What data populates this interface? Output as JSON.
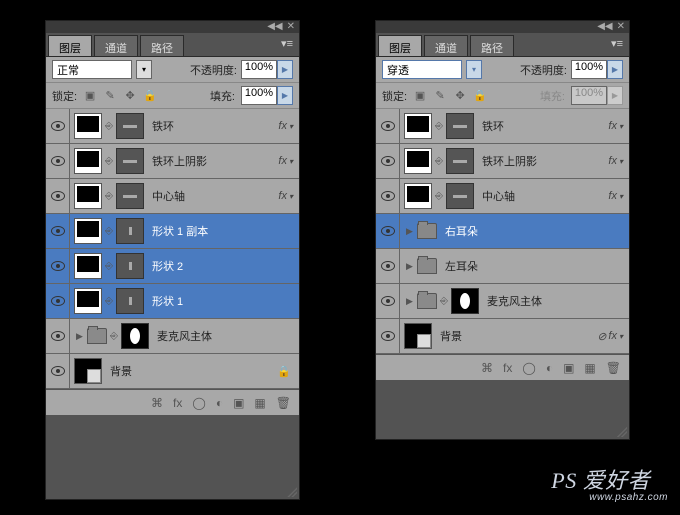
{
  "tabs": {
    "layers": "图层",
    "channels": "通道",
    "paths": "路径"
  },
  "blend": {
    "left": "正常",
    "right": "穿透"
  },
  "opacity": {
    "label": "不透明度:",
    "value": "100%"
  },
  "lock": {
    "label": "锁定:"
  },
  "fill": {
    "label": "填充:",
    "value": "100%"
  },
  "fx_label": "fx",
  "left_layers": [
    {
      "name": "铁环",
      "mask": "bar",
      "selected": false,
      "fx": true,
      "type": "shape"
    },
    {
      "name": "铁环上阴影",
      "mask": "bar",
      "selected": false,
      "fx": true,
      "type": "shape"
    },
    {
      "name": "中心轴",
      "mask": "bar",
      "selected": false,
      "fx": true,
      "type": "shape"
    },
    {
      "name": "形状 1 副本",
      "mask": "dot",
      "selected": true,
      "fx": false,
      "type": "shape"
    },
    {
      "name": "形状 2",
      "mask": "dot",
      "selected": true,
      "fx": false,
      "type": "shape"
    },
    {
      "name": "形状 1",
      "mask": "dot",
      "selected": true,
      "fx": false,
      "type": "shape"
    },
    {
      "name": "麦克风主体",
      "type": "folder-mask",
      "selected": false,
      "fx": false
    },
    {
      "name": "背景",
      "type": "bg",
      "selected": false,
      "fx": false
    }
  ],
  "right_layers": [
    {
      "name": "铁环",
      "mask": "bar",
      "selected": false,
      "fx": true,
      "type": "shape"
    },
    {
      "name": "铁环上阴影",
      "mask": "bar",
      "selected": false,
      "fx": true,
      "type": "shape"
    },
    {
      "name": "中心轴",
      "mask": "bar",
      "selected": false,
      "fx": true,
      "type": "shape"
    },
    {
      "name": "右耳朵",
      "type": "folder",
      "selected": true,
      "fx": false
    },
    {
      "name": "左耳朵",
      "type": "folder",
      "selected": false,
      "fx": false
    },
    {
      "name": "麦克风主体",
      "type": "folder-mask",
      "selected": false,
      "fx": false
    },
    {
      "name": "背景",
      "type": "bg",
      "selected": false,
      "fx": true
    }
  ],
  "watermark": {
    "main": "PS 爱好者",
    "url": "www.psahz.com"
  }
}
